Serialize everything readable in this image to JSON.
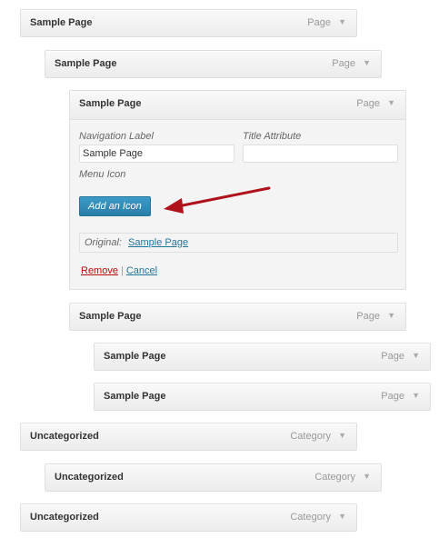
{
  "menu_items": [
    {
      "title": "Sample Page",
      "type": "Page"
    },
    {
      "title": "Sample Page",
      "type": "Page"
    },
    {
      "title": "Sample Page",
      "type": "Page"
    },
    {
      "title": "Sample Page",
      "type": "Page"
    },
    {
      "title": "Sample Page",
      "type": "Page"
    },
    {
      "title": "Sample Page",
      "type": "Page"
    },
    {
      "title": "Uncategorized",
      "type": "Category"
    },
    {
      "title": "Uncategorized",
      "type": "Category"
    },
    {
      "title": "Uncategorized",
      "type": "Category"
    }
  ],
  "edit_panel": {
    "navigation_label": "Navigation Label",
    "navigation_label_value": "Sample Page",
    "title_attribute": "Title Attribute",
    "title_attribute_value": "",
    "menu_icon": "Menu Icon",
    "add_icon_button": "Add an Icon",
    "original_label": "Original:",
    "original_link": "Sample Page",
    "remove": "Remove",
    "separator": "|",
    "cancel": "Cancel"
  },
  "colors": {
    "annotation_arrow": "#b0121b",
    "button_blue": "#2a7ea9",
    "remove_red": "#bc0b0b",
    "link_blue": "#21759b"
  },
  "icons": {
    "toggle": "triangle-down-icon",
    "annotation": "red-arrow-icon"
  }
}
